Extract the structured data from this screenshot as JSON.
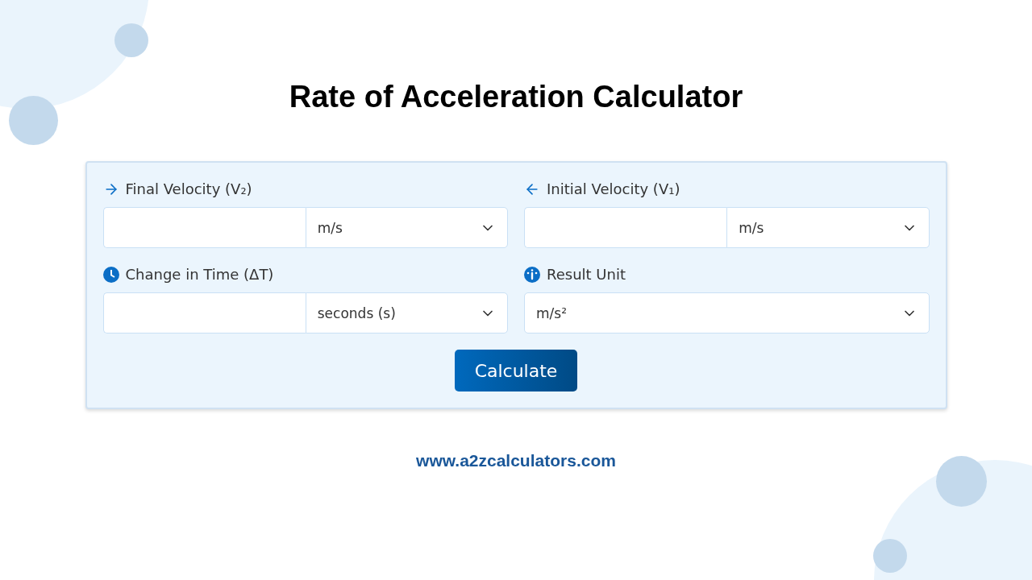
{
  "title": "Rate of Acceleration Calculator",
  "fields": [
    {
      "kind": "value_unit",
      "label": "Final Velocity (V₂)",
      "unit": "m/s"
    },
    {
      "kind": "value_unit",
      "label": "Initial Velocity (V₁)",
      "unit": "m/s"
    },
    {
      "kind": "value_unit",
      "label": "Change in Time (ΔT)",
      "unit": "seconds (s)"
    },
    {
      "kind": "unit_only",
      "label": "Result Unit",
      "unit": "m/s²"
    }
  ],
  "button": "Calculate",
  "footer": "www.a2zcalculators.com"
}
